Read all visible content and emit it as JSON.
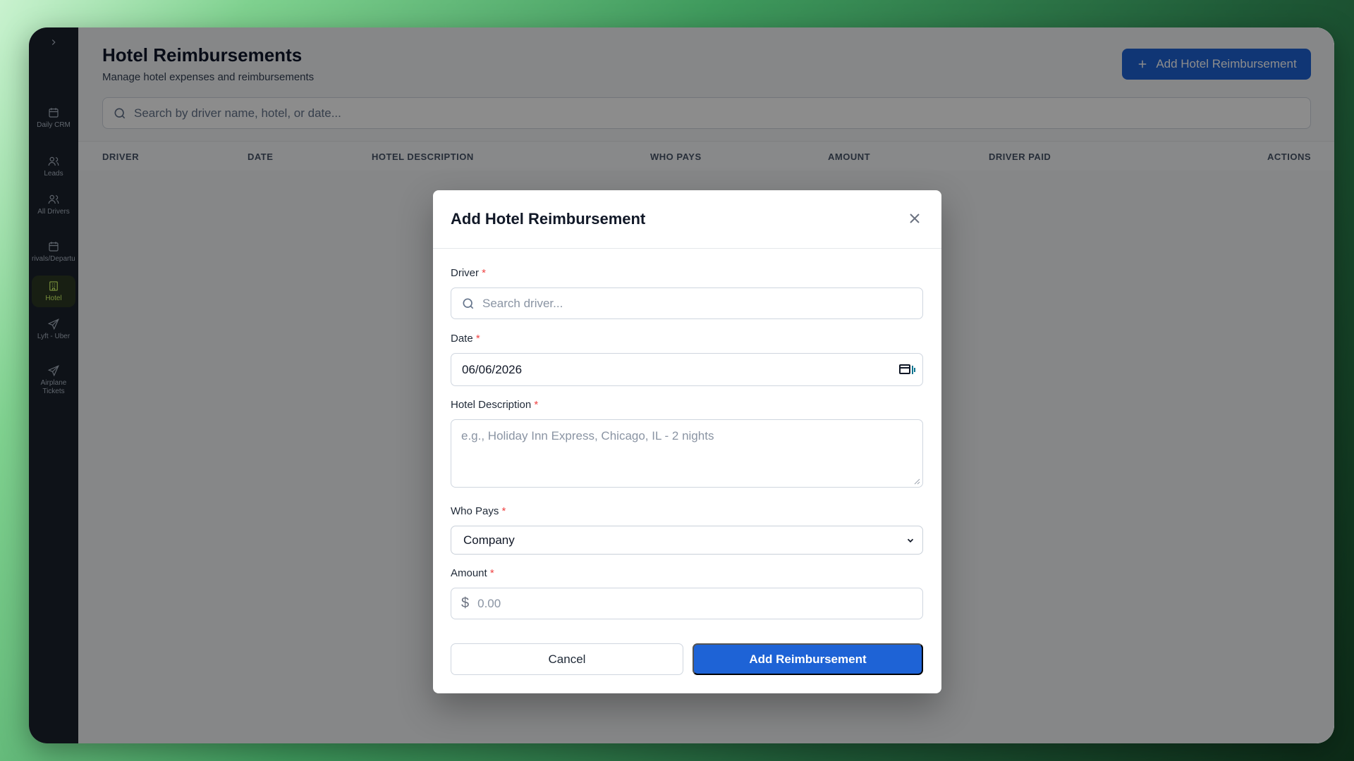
{
  "sidebar": {
    "toggle_icon": "chevron-right-icon",
    "items": [
      {
        "label": "Daily CRM",
        "icon": "calendar-icon"
      },
      {
        "label": "Leads",
        "icon": "users-icon"
      },
      {
        "label": "All Drivers",
        "icon": "users-icon"
      },
      {
        "label": "Arrivals/Departures",
        "icon": "calendar-icon"
      },
      {
        "label": "Hotel",
        "icon": "hotel-icon",
        "active": true
      },
      {
        "label": "Lyft - Uber",
        "icon": "send-icon"
      },
      {
        "label": "Airplane Tickets",
        "icon": "send-icon"
      }
    ]
  },
  "header": {
    "title": "Hotel Reimbursements",
    "subtitle": "Manage hotel expenses and reimbursements",
    "add_button": "Add Hotel Reimbursement"
  },
  "search": {
    "placeholder": "Search by driver name, hotel, or date..."
  },
  "table": {
    "columns": [
      "DRIVER",
      "DATE",
      "HOTEL DESCRIPTION",
      "WHO PAYS",
      "AMOUNT",
      "DRIVER PAID",
      "ACTIONS"
    ]
  },
  "modal": {
    "title": "Add Hotel Reimbursement",
    "driver_label": "Driver",
    "driver_placeholder": "Search driver...",
    "date_label": "Date",
    "date_value": "06/06/2026",
    "description_label": "Hotel Description",
    "description_placeholder": "e.g., Holiday Inn Express, Chicago, IL - 2 nights",
    "who_pays_label": "Who Pays",
    "who_pays_value": "Company",
    "amount_label": "Amount",
    "amount_currency": "$",
    "amount_placeholder": "0.00",
    "required_mark": "*",
    "cancel_button": "Cancel",
    "submit_button": "Add Reimbursement"
  },
  "colors": {
    "accent": "#1e63d6",
    "sidebar_bg": "#1b222c",
    "active_nav": "#d7ff6b",
    "required": "#ef4444"
  }
}
